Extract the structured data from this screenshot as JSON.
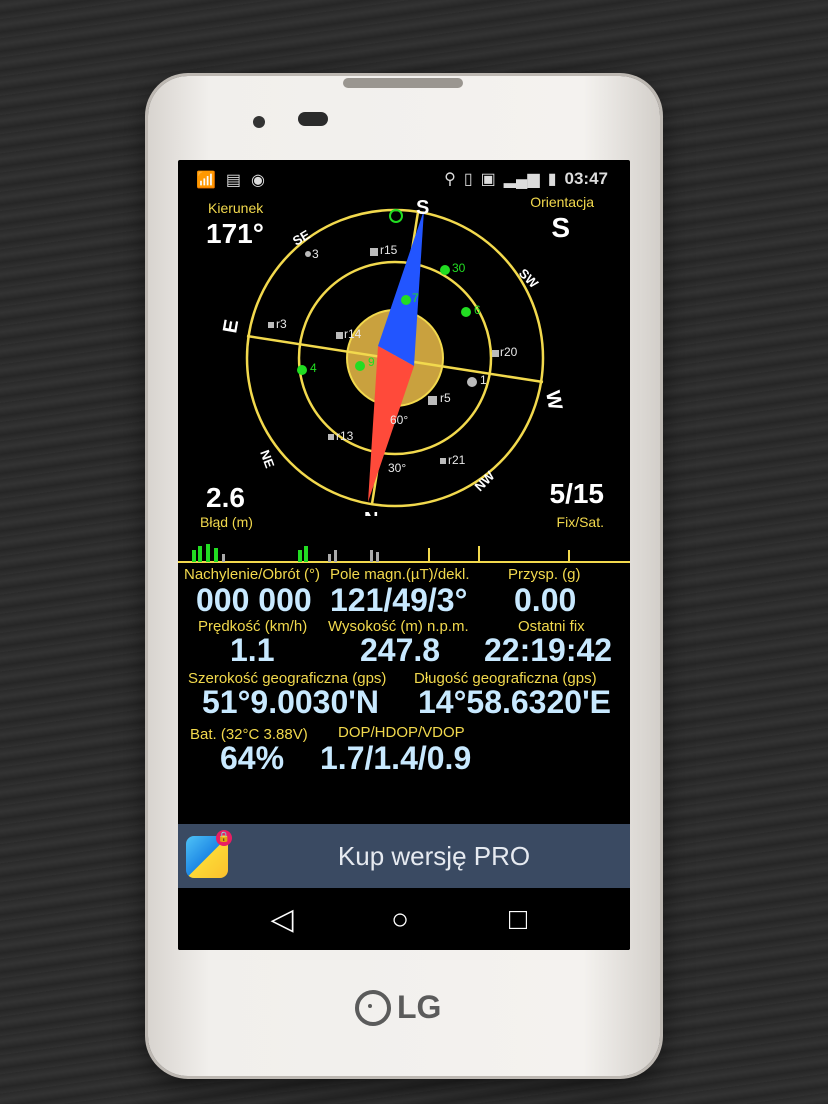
{
  "status_bar": {
    "left_icons": [
      "cast-icon",
      "message-icon",
      "sync-icon"
    ],
    "right_icons": [
      "location-icon",
      "vibrate-icon",
      "nfc-icon",
      "signal-icon",
      "battery-icon"
    ],
    "time": "03:47"
  },
  "header": {
    "heading_label": "Kierunek",
    "heading_value": "171°",
    "orientation_label": "Orientacja",
    "orientation_value": "S"
  },
  "compass": {
    "directions": [
      "S",
      "SW",
      "W",
      "NW",
      "N",
      "NE",
      "E",
      "SE"
    ],
    "ring_labels": [
      "30°",
      "60°"
    ],
    "satellites": [
      {
        "id": "30",
        "fix": true
      },
      {
        "id": "7",
        "fix": true
      },
      {
        "id": "6",
        "fix": true
      },
      {
        "id": "9",
        "fix": true
      },
      {
        "id": "4",
        "fix": true
      },
      {
        "id": "r15",
        "fix": false
      },
      {
        "id": "r3",
        "fix": false
      },
      {
        "id": "3",
        "fix": false
      },
      {
        "id": "r14",
        "fix": false
      },
      {
        "id": "r20",
        "fix": false
      },
      {
        "id": "1",
        "fix": false
      },
      {
        "id": "r5",
        "fix": false
      },
      {
        "id": "r13",
        "fix": false
      },
      {
        "id": "r21",
        "fix": false
      }
    ],
    "colors": {
      "ring": "#f2d94d",
      "fix": "#22dd22",
      "nofix": "#bbbbbb",
      "needle_north": "#ff4a3a",
      "needle_south": "#2255ff"
    }
  },
  "error": {
    "value": "2.6",
    "label": "Błąd (m)"
  },
  "fix_sat": {
    "value": "5/15",
    "label": "Fix/Sat."
  },
  "metrics": {
    "tilt": {
      "label": "Nachylenie/Obrót (°)",
      "value": "000 000"
    },
    "mag": {
      "label": "Pole magn.(µT)/dekl.",
      "value": "121/49/3°"
    },
    "accel": {
      "label": "Przysp. (g)",
      "value": "0.00"
    },
    "speed": {
      "label": "Prędkość (km/h)",
      "value": "1.1"
    },
    "altitude": {
      "label": "Wysokość (m) n.p.m.",
      "value": "247.8"
    },
    "last_fix": {
      "label": "Ostatni fix",
      "value": "22:19:42"
    },
    "latitude": {
      "label": "Szerokość geograficzna (gps)",
      "value": "51°9.0030'N"
    },
    "longitude": {
      "label": "Długość geograficzna (gps)",
      "value": "14°58.6320'E"
    },
    "battery": {
      "label": "Bat. (32°C 3.88V)",
      "value": "64%"
    },
    "dop": {
      "label": "DOP/HDOP/VDOP",
      "value": "1.7/1.4/0.9"
    }
  },
  "pro_bar": {
    "label": "Kup wersję PRO"
  },
  "nav": {
    "back": "◁",
    "home": "○",
    "recent": "□"
  },
  "brand": "LG"
}
